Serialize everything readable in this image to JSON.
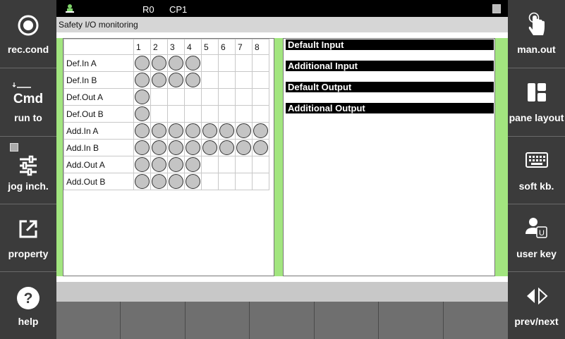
{
  "status": {
    "robot": "R0",
    "program": "CP1"
  },
  "title": "Safety I/O monitoring",
  "left_buttons": [
    {
      "label": "rec.cond",
      "icon": "record-circle-icon"
    },
    {
      "label": "run to",
      "icon": "cmd-text-icon",
      "icon_text": "Cmd"
    },
    {
      "label": "jog inch.",
      "icon": "sliders-icon"
    },
    {
      "label": "property",
      "icon": "external-link-icon"
    },
    {
      "label": "help",
      "icon": "help-question-icon"
    }
  ],
  "right_buttons": [
    {
      "label": "man.out",
      "icon": "hand-pointer-icon"
    },
    {
      "label": "pane layout",
      "icon": "pane-layout-icon"
    },
    {
      "label": "soft kb.",
      "icon": "keyboard-icon"
    },
    {
      "label": "user key",
      "icon": "user-key-icon"
    },
    {
      "label": "prev/next",
      "icon": "prev-next-arrows-icon"
    }
  ],
  "grid": {
    "columns": [
      "1",
      "2",
      "3",
      "4",
      "5",
      "6",
      "7",
      "8"
    ],
    "rows": [
      {
        "label": "Def.In A",
        "count": 4
      },
      {
        "label": "Def.In B",
        "count": 4
      },
      {
        "label": "Def.Out A",
        "count": 1
      },
      {
        "label": "Def.Out B",
        "count": 1
      },
      {
        "label": "Add.In A",
        "count": 8
      },
      {
        "label": "Add.In B",
        "count": 8
      },
      {
        "label": "Add.Out A",
        "count": 4
      },
      {
        "label": "Add.Out B",
        "count": 4
      }
    ]
  },
  "sections": [
    "Default Input",
    "Additional Input",
    "Default Output",
    "Additional Output"
  ],
  "colors": {
    "accent_green": "#a2e57f",
    "panel": "#3b3b3b",
    "indicator": "#c4c4c4"
  }
}
